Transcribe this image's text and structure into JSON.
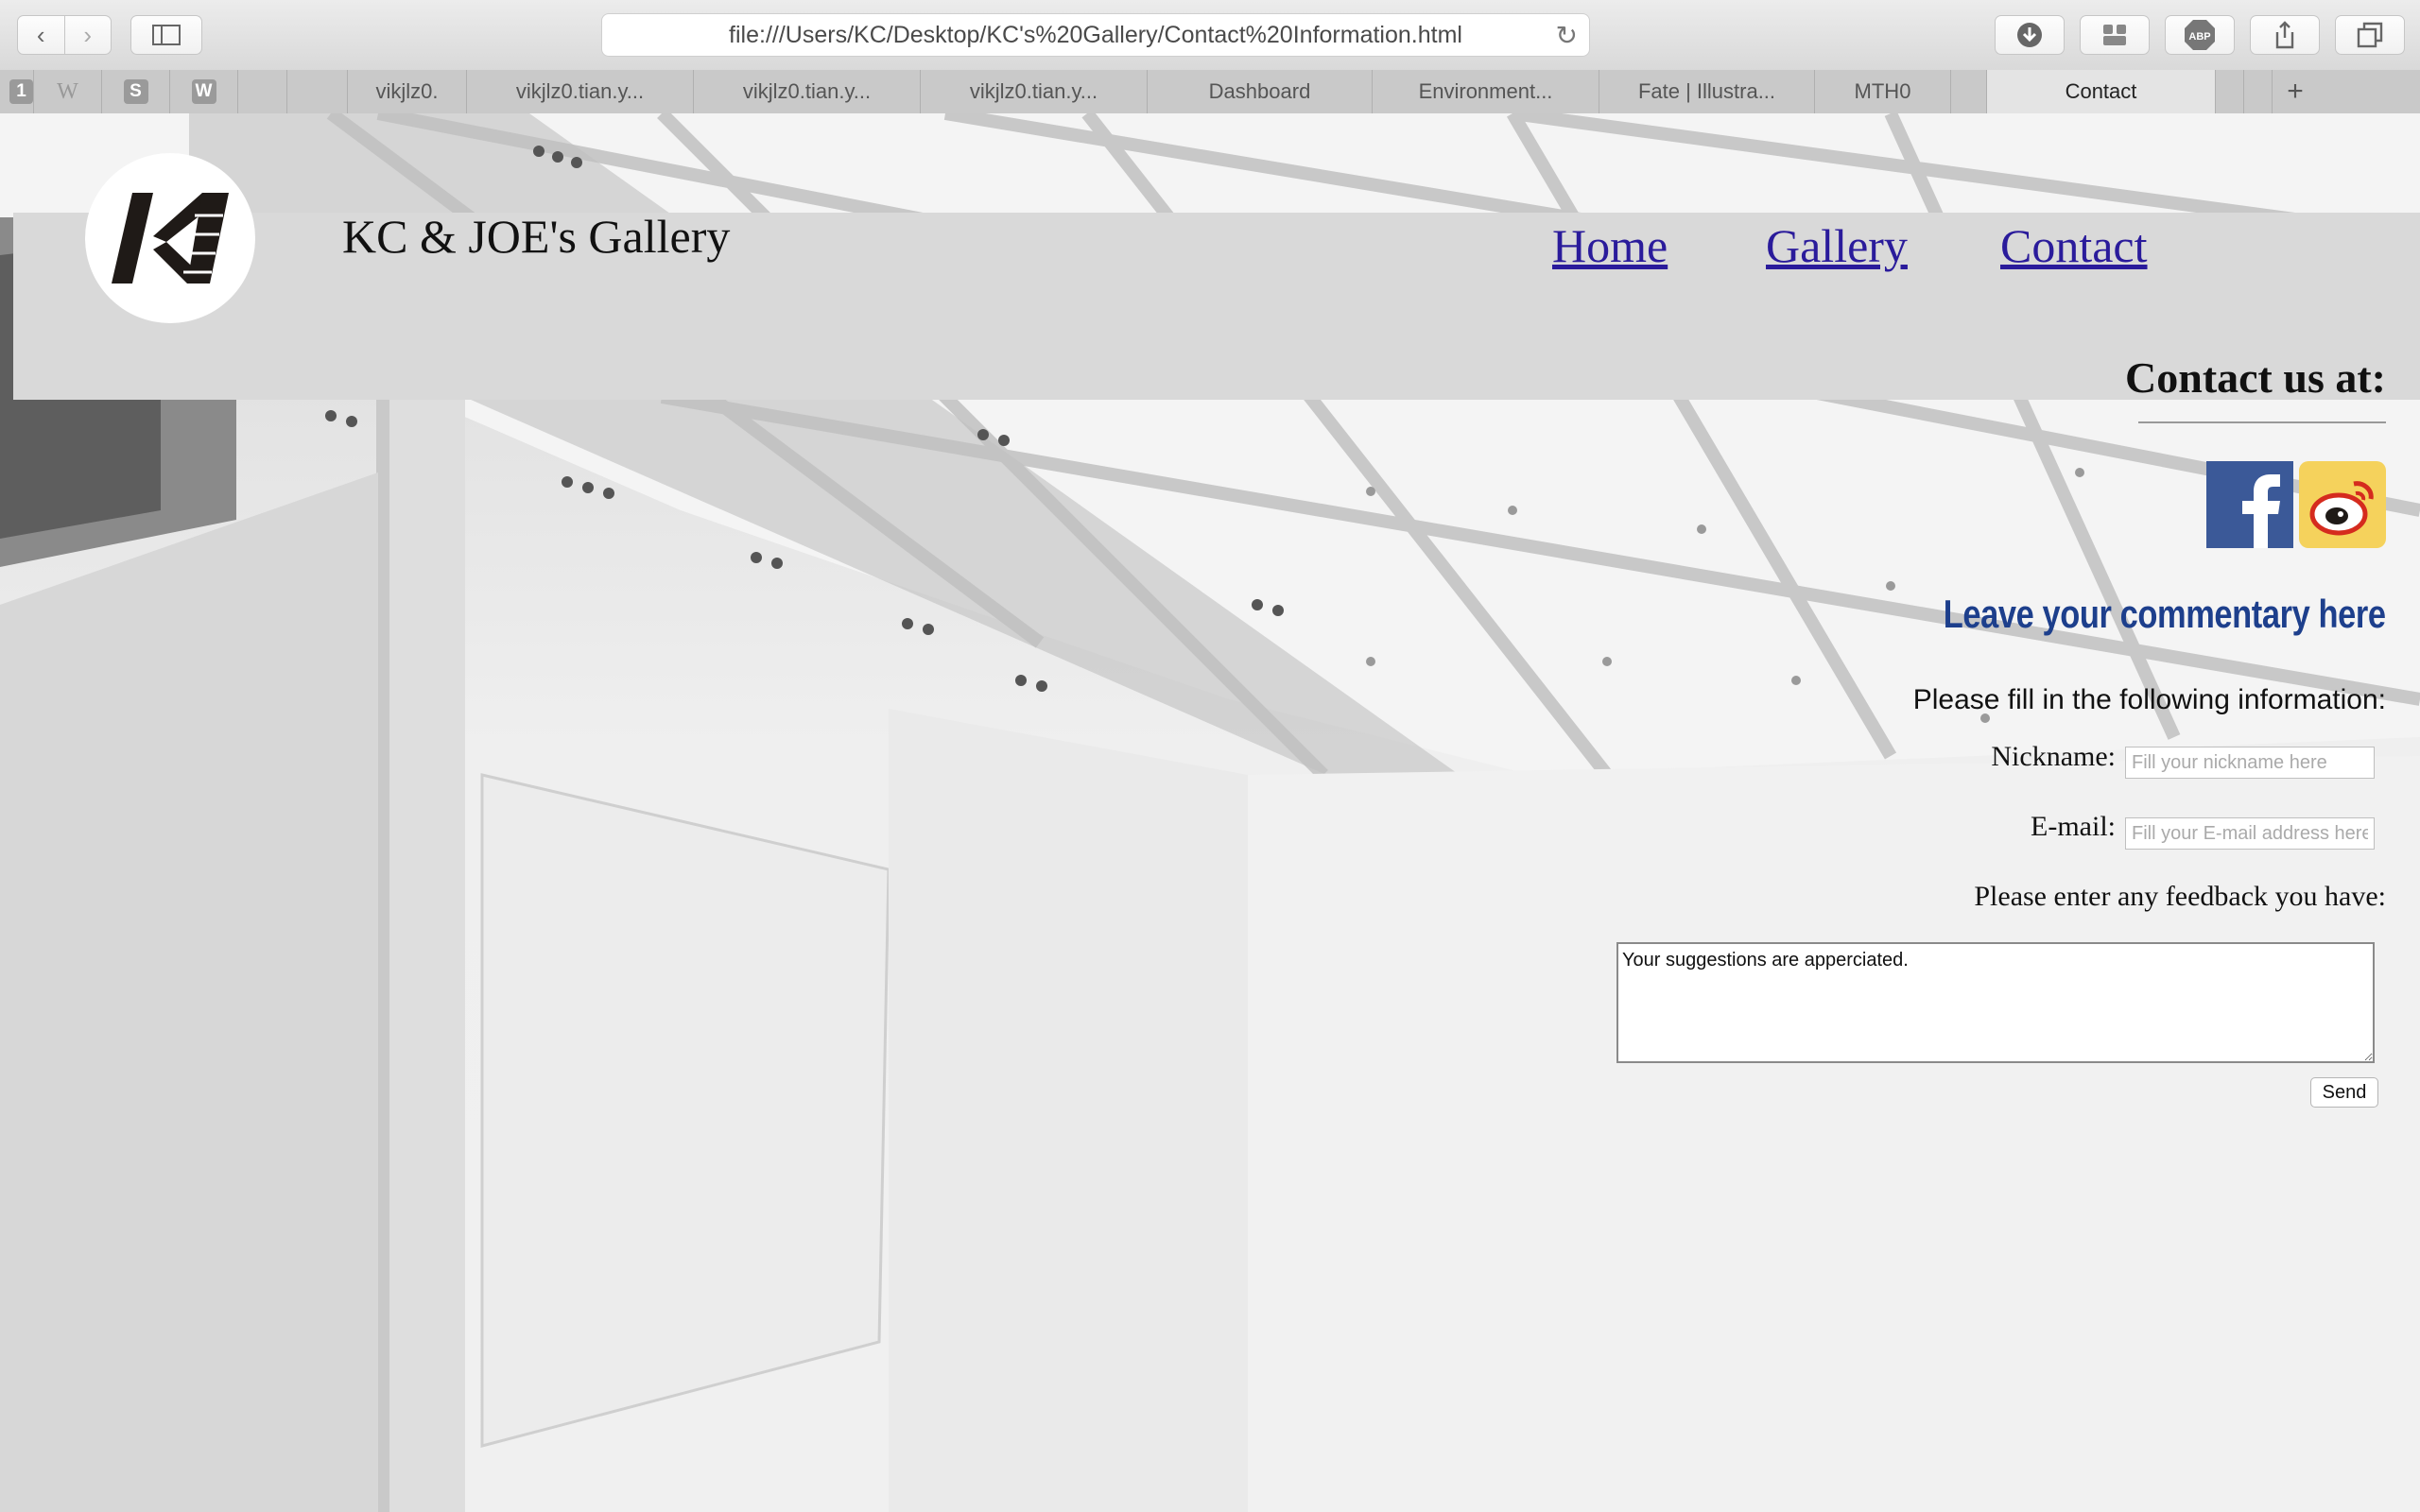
{
  "browser": {
    "url": "file:///Users/KC/Desktop/KC's%20Gallery/Contact%20Information.html",
    "tabs": [
      {
        "label": "vikjlz0."
      },
      {
        "label": "vikjlz0.tian.y..."
      },
      {
        "label": "vikjlz0.tian.y..."
      },
      {
        "label": "vikjlz0.tian.y..."
      },
      {
        "label": "Dashboard"
      },
      {
        "label": "Environment..."
      },
      {
        "label": "Fate | Illustra..."
      },
      {
        "label": "MTH0"
      },
      {
        "label": "Contact"
      }
    ],
    "pinned": [
      "1",
      "W",
      "S",
      "W"
    ],
    "toolbar_icons": [
      "back-icon",
      "forward-icon",
      "sidebar-icon",
      "download-icon",
      "extension-icon",
      "adblock-icon",
      "share-icon",
      "tabs-overview-icon"
    ],
    "adblock_label": "ABP"
  },
  "site": {
    "title": "KC & JOE's Gallery",
    "nav": {
      "home": "Home",
      "gallery": "Gallery",
      "contact": "Contact"
    }
  },
  "contact": {
    "heading": "Contact us at:",
    "social": [
      "facebook-icon",
      "weibo-icon"
    ],
    "leave_heading": "Leave your commentary here",
    "intro": "Please fill in the following information:",
    "nickname_label": "Nickname:",
    "nickname_placeholder": "Fill your nickname here",
    "email_label": "E-mail:",
    "email_placeholder": "Fill your E-mail address here",
    "feedback_label": "Please enter any feedback you have:",
    "feedback_value": "Your suggestions are apperciated.",
    "send_label": "Send"
  },
  "colors": {
    "link": "#2a1b9b",
    "leave_heading": "#1d3f8c",
    "header_band": "#d9d9d9",
    "facebook": "#3b5998"
  }
}
